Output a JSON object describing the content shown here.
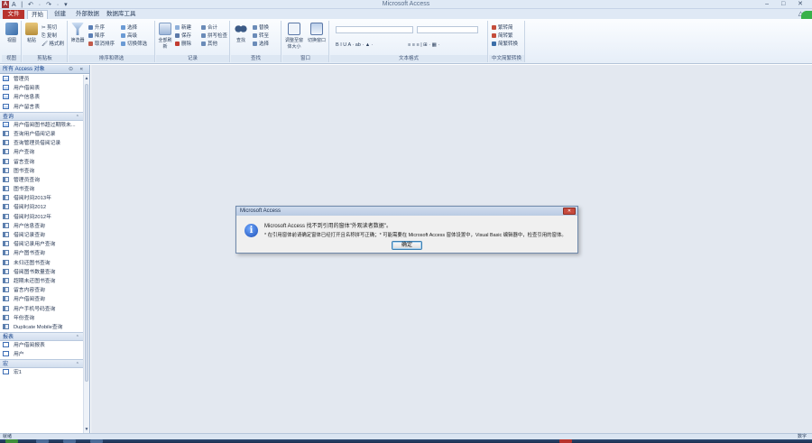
{
  "window": {
    "title": "Microsoft Access",
    "controls": "– □ ✕"
  },
  "quick_access": "A | ↶ · ↷ · ▾",
  "tabs": [
    {
      "label": "文件"
    },
    {
      "label": "开始"
    },
    {
      "label": "创建"
    },
    {
      "label": "外部数据"
    },
    {
      "label": "数据库工具"
    }
  ],
  "help_icon": "△ ?",
  "ribbon": {
    "groups": [
      {
        "label": "视图",
        "buttons": [
          "视图"
        ]
      },
      {
        "label": "剪贴板",
        "buttons": [
          "粘贴"
        ],
        "small": [
          "✂ 剪切",
          "⎘ 复制",
          "🖌 格式刷"
        ]
      },
      {
        "label": "排序和筛选",
        "buttons": [
          "筛选器"
        ],
        "small": [
          "升序",
          "降序",
          "取消排序",
          "选择",
          "高级",
          "切换筛选"
        ]
      },
      {
        "label": "记录",
        "buttons": [
          "全部刷新"
        ],
        "small": [
          "新建",
          "保存",
          "删除",
          "合计",
          "拼写检查",
          "其他"
        ]
      },
      {
        "label": "查找",
        "buttons": [
          "查找"
        ],
        "small": [
          "替换",
          "转至",
          "选择"
        ]
      },
      {
        "label": "窗口",
        "buttons": [
          "调整至窗体大小",
          "切换窗口"
        ]
      },
      {
        "label": "文本格式",
        "small": [
          "B I U  A · ab · ▲ ·",
          "≡ ≡ ≡ | ⊞ · ▦ ·"
        ]
      },
      {
        "label": "中文简繁转换",
        "small": [
          "繁转简",
          "简转繁",
          "简繁转换"
        ]
      }
    ]
  },
  "nav": {
    "title": "所有 Access 对象",
    "header_controls": "⊙ «",
    "groups": [
      {
        "label": "",
        "items": [
          {
            "icon": "table",
            "label": "管理员"
          },
          {
            "icon": "table",
            "label": "用户借阅表"
          },
          {
            "icon": "table",
            "label": "用户信息表"
          },
          {
            "icon": "table",
            "label": "用户留言表"
          }
        ]
      },
      {
        "label": "查询",
        "items": [
          {
            "icon": "table",
            "label": "用户借阅图书超过期限未..."
          },
          {
            "icon": "query",
            "label": "查询用户借阅记录"
          },
          {
            "icon": "query",
            "label": "查询管理员借阅记录"
          },
          {
            "icon": "query",
            "label": "用户查询"
          },
          {
            "icon": "query",
            "label": "留言查询"
          },
          {
            "icon": "query",
            "label": "图书查询"
          },
          {
            "icon": "query",
            "label": "管理员查询"
          },
          {
            "icon": "query",
            "label": "图书查询"
          },
          {
            "icon": "query",
            "label": "借阅时间2013年"
          },
          {
            "icon": "query",
            "label": "借阅时间2012"
          },
          {
            "icon": "query",
            "label": "借阅时间2012年"
          },
          {
            "icon": "query",
            "label": "用户信息查询"
          },
          {
            "icon": "query",
            "label": "借阅记录查询"
          },
          {
            "icon": "query",
            "label": "借阅记录用户查询"
          },
          {
            "icon": "query",
            "label": "用户图书查询"
          },
          {
            "icon": "query",
            "label": "未归还图书查询"
          },
          {
            "icon": "query",
            "label": "借阅图书数量查询"
          },
          {
            "icon": "query",
            "label": "超期未还图书查询"
          },
          {
            "icon": "query",
            "label": "留言内容查询"
          },
          {
            "icon": "query",
            "label": "用户借阅查询"
          },
          {
            "icon": "query",
            "label": "用户手机号码查询"
          },
          {
            "icon": "query",
            "label": "年份查询"
          },
          {
            "icon": "query",
            "label": "Duplicate Mobile查询"
          }
        ]
      },
      {
        "label": "报表",
        "items": [
          {
            "icon": "report",
            "label": "用户借阅报表"
          },
          {
            "icon": "report",
            "label": "用户"
          }
        ]
      },
      {
        "label": "宏",
        "items": [
          {
            "icon": "report",
            "label": "宏1"
          }
        ]
      }
    ]
  },
  "status": {
    "left": "就绪",
    "right": "数字"
  },
  "dialog": {
    "title": "Microsoft Access",
    "message_line1": "Microsoft Access 找不到引用的窗体\"外观读者数据\"。",
    "message_line2": "* 在引用窗体前请确定窗体已经打开且名称拼写正确；* 可能需要在 Microsoft Access 窗体设置中，Visual Basic 编辑器中，检查引用的窗体。",
    "ok_label": "确定"
  }
}
